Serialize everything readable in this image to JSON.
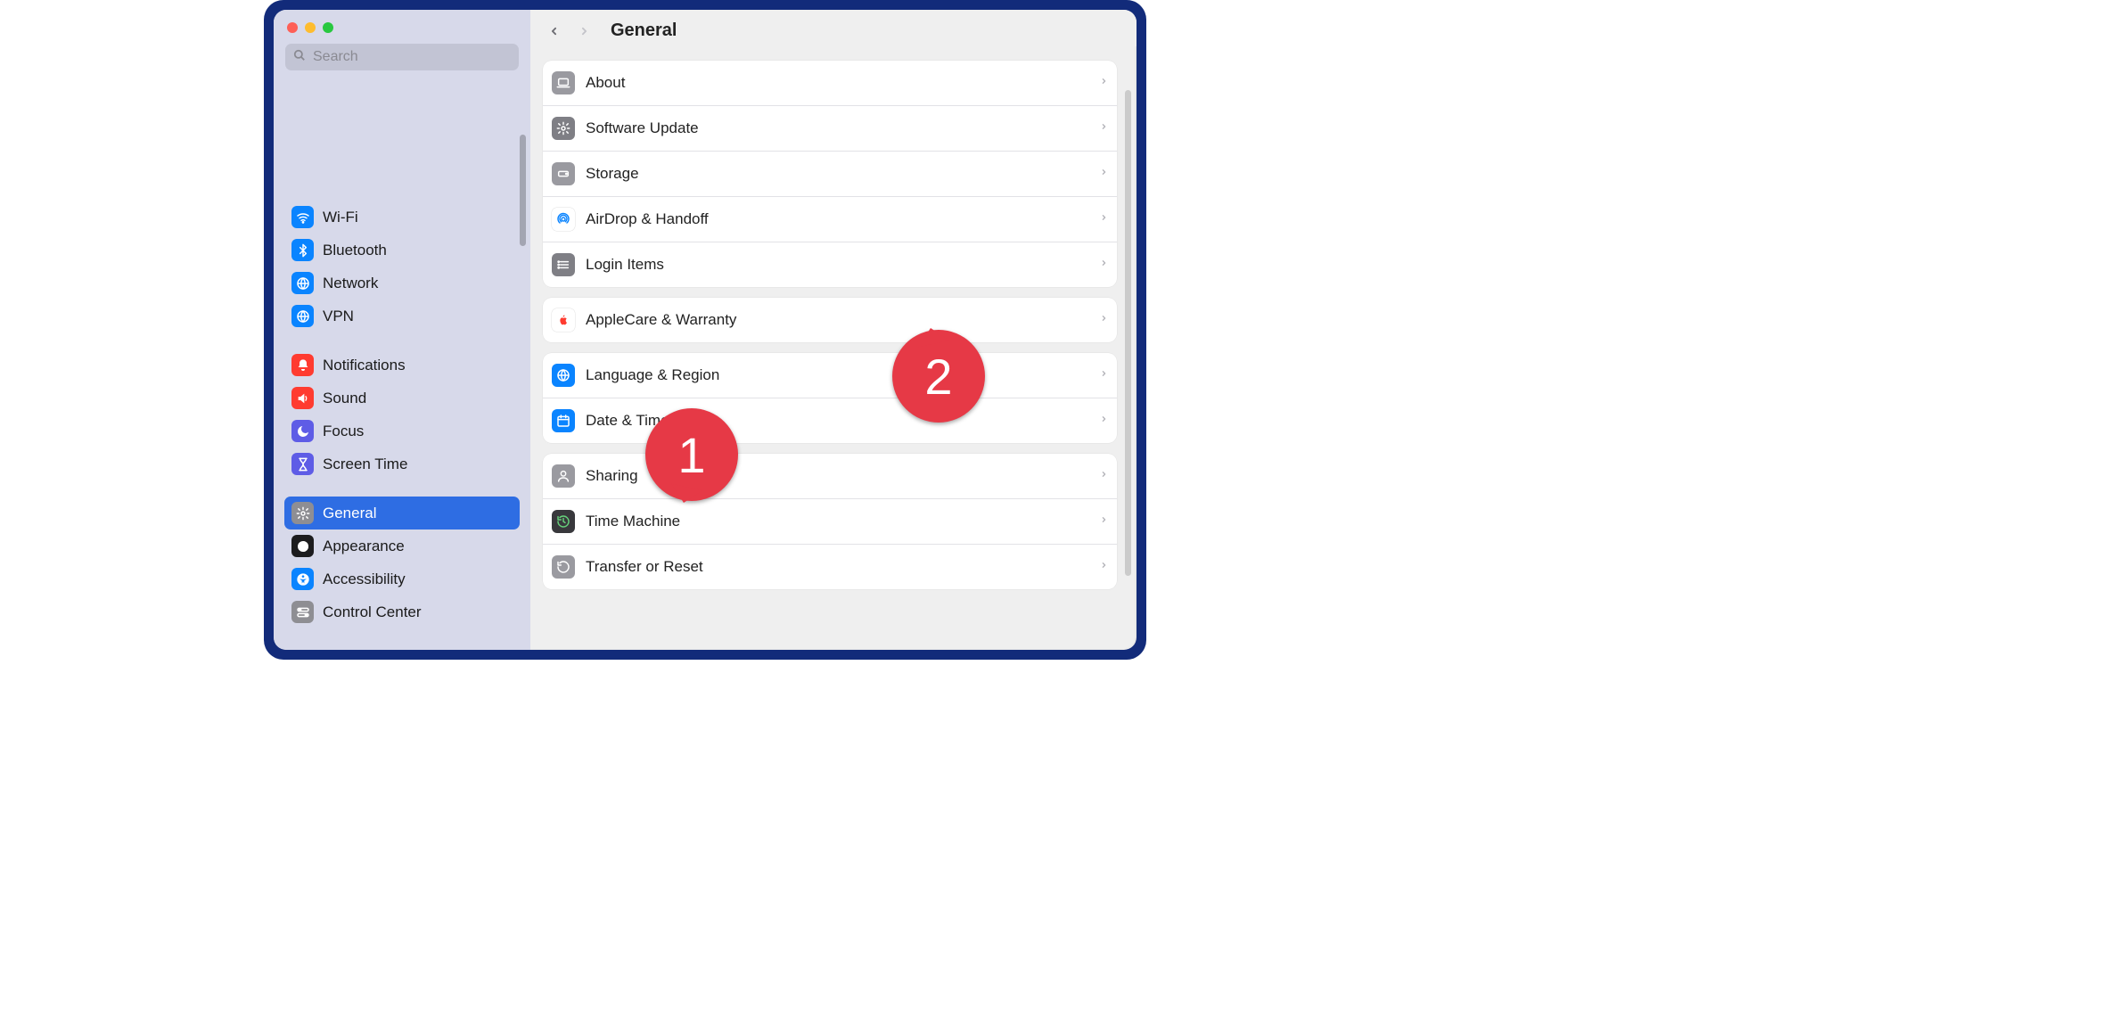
{
  "header": {
    "title": "General"
  },
  "search": {
    "placeholder": "Search"
  },
  "sidebar": {
    "groups": [
      [
        {
          "id": "wifi",
          "label": "Wi-Fi",
          "iconName": "wifi-icon",
          "iconBg": "#0a84ff",
          "glyph": "wifi",
          "glyphColor": "#fff"
        },
        {
          "id": "bluetooth",
          "label": "Bluetooth",
          "iconName": "bluetooth-icon",
          "iconBg": "#0a84ff",
          "glyph": "bt",
          "glyphColor": "#fff"
        },
        {
          "id": "network",
          "label": "Network",
          "iconName": "network-icon",
          "iconBg": "#0a84ff",
          "glyph": "globe",
          "glyphColor": "#fff"
        },
        {
          "id": "vpn",
          "label": "VPN",
          "iconName": "vpn-icon",
          "iconBg": "#0a84ff",
          "glyph": "globe",
          "glyphColor": "#fff"
        }
      ],
      [
        {
          "id": "notifications",
          "label": "Notifications",
          "iconName": "notifications-icon",
          "iconBg": "#ff3b30",
          "glyph": "bell",
          "glyphColor": "#fff"
        },
        {
          "id": "sound",
          "label": "Sound",
          "iconName": "sound-icon",
          "iconBg": "#ff3b30",
          "glyph": "speaker",
          "glyphColor": "#fff"
        },
        {
          "id": "focus",
          "label": "Focus",
          "iconName": "focus-icon",
          "iconBg": "#5e5ce6",
          "glyph": "moon",
          "glyphColor": "#fff"
        },
        {
          "id": "screentime",
          "label": "Screen Time",
          "iconName": "screentime-icon",
          "iconBg": "#5e5ce6",
          "glyph": "hourglass",
          "glyphColor": "#fff"
        }
      ],
      [
        {
          "id": "general",
          "label": "General",
          "iconName": "general-icon",
          "iconBg": "#8e8e93",
          "glyph": "gear",
          "glyphColor": "#fff",
          "selected": true
        },
        {
          "id": "appearance",
          "label": "Appearance",
          "iconName": "appearance-icon",
          "iconBg": "#1c1c1e",
          "glyph": "appearance",
          "glyphColor": "#fff"
        },
        {
          "id": "accessibility",
          "label": "Accessibility",
          "iconName": "accessibility-icon",
          "iconBg": "#0a84ff",
          "glyph": "accessibility",
          "glyphColor": "#fff"
        },
        {
          "id": "controlcenter",
          "label": "Control Center",
          "iconName": "control-center-icon",
          "iconBg": "#8e8e93",
          "glyph": "toggles",
          "glyphColor": "#fff"
        }
      ]
    ]
  },
  "panels": [
    [
      {
        "id": "about",
        "label": "About",
        "iconName": "about-icon",
        "iconBg": "#9a9aa0",
        "glyph": "laptop",
        "glyphColor": "#fff"
      },
      {
        "id": "softwareupdate",
        "label": "Software Update",
        "iconName": "software-update-icon",
        "iconBg": "#7f7f85",
        "glyph": "gear",
        "glyphColor": "#fff"
      },
      {
        "id": "storage",
        "label": "Storage",
        "iconName": "storage-icon",
        "iconBg": "#9a9aa0",
        "glyph": "drive",
        "glyphColor": "#fff"
      },
      {
        "id": "airdrop",
        "label": "AirDrop & Handoff",
        "iconName": "airdrop-icon",
        "iconBg": "#ffffff",
        "glyph": "airdrop",
        "glyphColor": "#0a84ff"
      },
      {
        "id": "loginitems",
        "label": "Login Items",
        "iconName": "login-items-icon",
        "iconBg": "#7f7f85",
        "glyph": "list",
        "glyphColor": "#fff"
      }
    ],
    [
      {
        "id": "applecare",
        "label": "AppleCare & Warranty",
        "iconName": "applecare-icon",
        "iconBg": "#ffffff",
        "glyph": "apple",
        "glyphColor": "#ff3b30"
      }
    ],
    [
      {
        "id": "language",
        "label": "Language & Region",
        "iconName": "language-region-icon",
        "iconBg": "#0a84ff",
        "glyph": "globe",
        "glyphColor": "#fff"
      },
      {
        "id": "datetime",
        "label": "Date & Time",
        "iconName": "date-time-icon",
        "iconBg": "#0a84ff",
        "glyph": "calendar",
        "glyphColor": "#fff"
      }
    ],
    [
      {
        "id": "sharing",
        "label": "Sharing",
        "iconName": "sharing-icon",
        "iconBg": "#9a9aa0",
        "glyph": "person",
        "glyphColor": "#fff"
      },
      {
        "id": "timemachine",
        "label": "Time Machine",
        "iconName": "time-machine-icon",
        "iconBg": "#38383c",
        "glyph": "clockback",
        "glyphColor": "#66d17b"
      },
      {
        "id": "transfer",
        "label": "Transfer or Reset",
        "iconName": "transfer-reset-icon",
        "iconBg": "#9a9aa0",
        "glyph": "reset",
        "glyphColor": "#fff"
      }
    ]
  ],
  "callouts": [
    {
      "number": "1"
    },
    {
      "number": "2"
    }
  ]
}
